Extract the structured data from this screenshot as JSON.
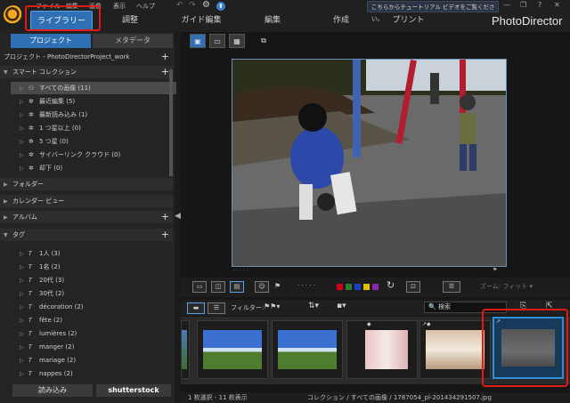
{
  "menubar": {
    "items": [
      "ファイル",
      "編集",
      "画像",
      "表示",
      "ヘルプ"
    ]
  },
  "modes": {
    "items": [
      "ライブラリー",
      "調整",
      "ガイド編集",
      "編集",
      "作成",
      "プリント"
    ]
  },
  "tutorial_banner": "こちらからチュートリアル ビデオをご覧ください。",
  "brand": "PhotoDirector",
  "left_panel": {
    "tabs": [
      "プロジェクト",
      "メタデータ"
    ],
    "project_label": "プロジェクト - PhotoDirectorProject_work",
    "smart_collection_label": "スマート コレクション",
    "smart_items": [
      {
        "label": "すべての画像 (11)"
      },
      {
        "label": "最近編集 (5)"
      },
      {
        "label": "最新読み込み (1)"
      },
      {
        "label": "1 つ星以上 (0)"
      },
      {
        "label": "5 つ星 (0)"
      },
      {
        "label": "サイバーリンク クラウド (0)"
      },
      {
        "label": "却下 (0)"
      }
    ],
    "sections": [
      "フォルダー",
      "カレンダー ビュー",
      "アルバム",
      "タグ"
    ],
    "tags": [
      {
        "label": "1人 (3)"
      },
      {
        "label": "1名 (2)"
      },
      {
        "label": "20代 (3)"
      },
      {
        "label": "30代 (2)"
      },
      {
        "label": "décoration (2)"
      },
      {
        "label": "fête (2)"
      },
      {
        "label": "lumières (2)"
      },
      {
        "label": "manger (2)"
      },
      {
        "label": "mariage (2)"
      },
      {
        "label": "nappes (2)"
      }
    ],
    "import_label": "読み込み",
    "shutterstock_label": "shutterstock"
  },
  "controls": {
    "filter_label": "フィルター:",
    "search_placeholder": "検索",
    "zoom_label": "ズーム:",
    "zoom_value": "フィット",
    "rating_dots": "· · · · ·",
    "color_labels": [
      "#d0021b",
      "#2e7d32",
      "#1e40c8",
      "#e6c000",
      "#8e24aa"
    ]
  },
  "status": {
    "selection": "1 枚選択 - 11 枚表示",
    "path": "コレクション / すべての画像 / 1787054_pl-201434291507.jpg"
  },
  "colors": {
    "accent": "#2f6fb3",
    "highlight": "#e01919"
  }
}
